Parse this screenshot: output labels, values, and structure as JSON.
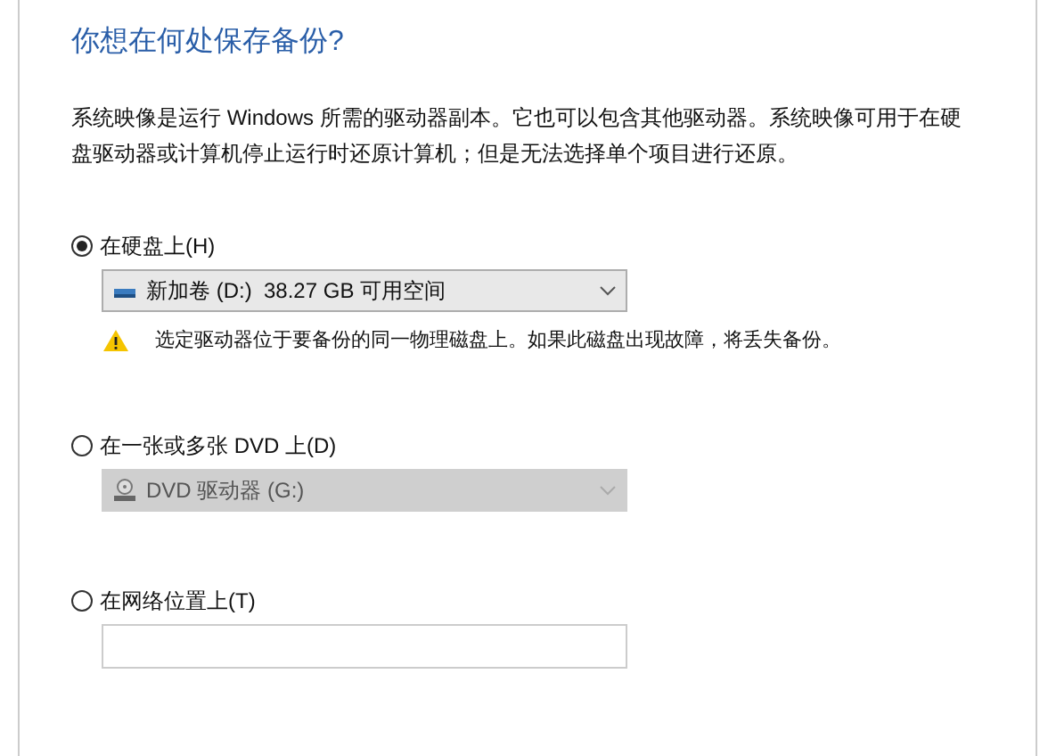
{
  "title": "你想在何处保存备份?",
  "description": "系统映像是运行 Windows 所需的驱动器副本。它也可以包含其他驱动器。系统映像可用于在硬盘驱动器或计算机停止运行时还原计算机；但是无法选择单个项目进行还原。",
  "options": [
    {
      "label": "在硬盘上(H)",
      "selected": true,
      "kind": "disk_select",
      "value": "新加卷 (D:)  38.27 GB 可用空间",
      "disabled": false,
      "warning": "选定驱动器位于要备份的同一物理磁盘上。如果此磁盘出现故障，将丢失备份。"
    },
    {
      "label": "在一张或多张 DVD 上(D)",
      "selected": false,
      "kind": "dvd_select",
      "value": "DVD 驱动器 (G:)",
      "disabled": true
    },
    {
      "label": "在网络位置上(T)",
      "selected": false,
      "kind": "path_field"
    }
  ]
}
